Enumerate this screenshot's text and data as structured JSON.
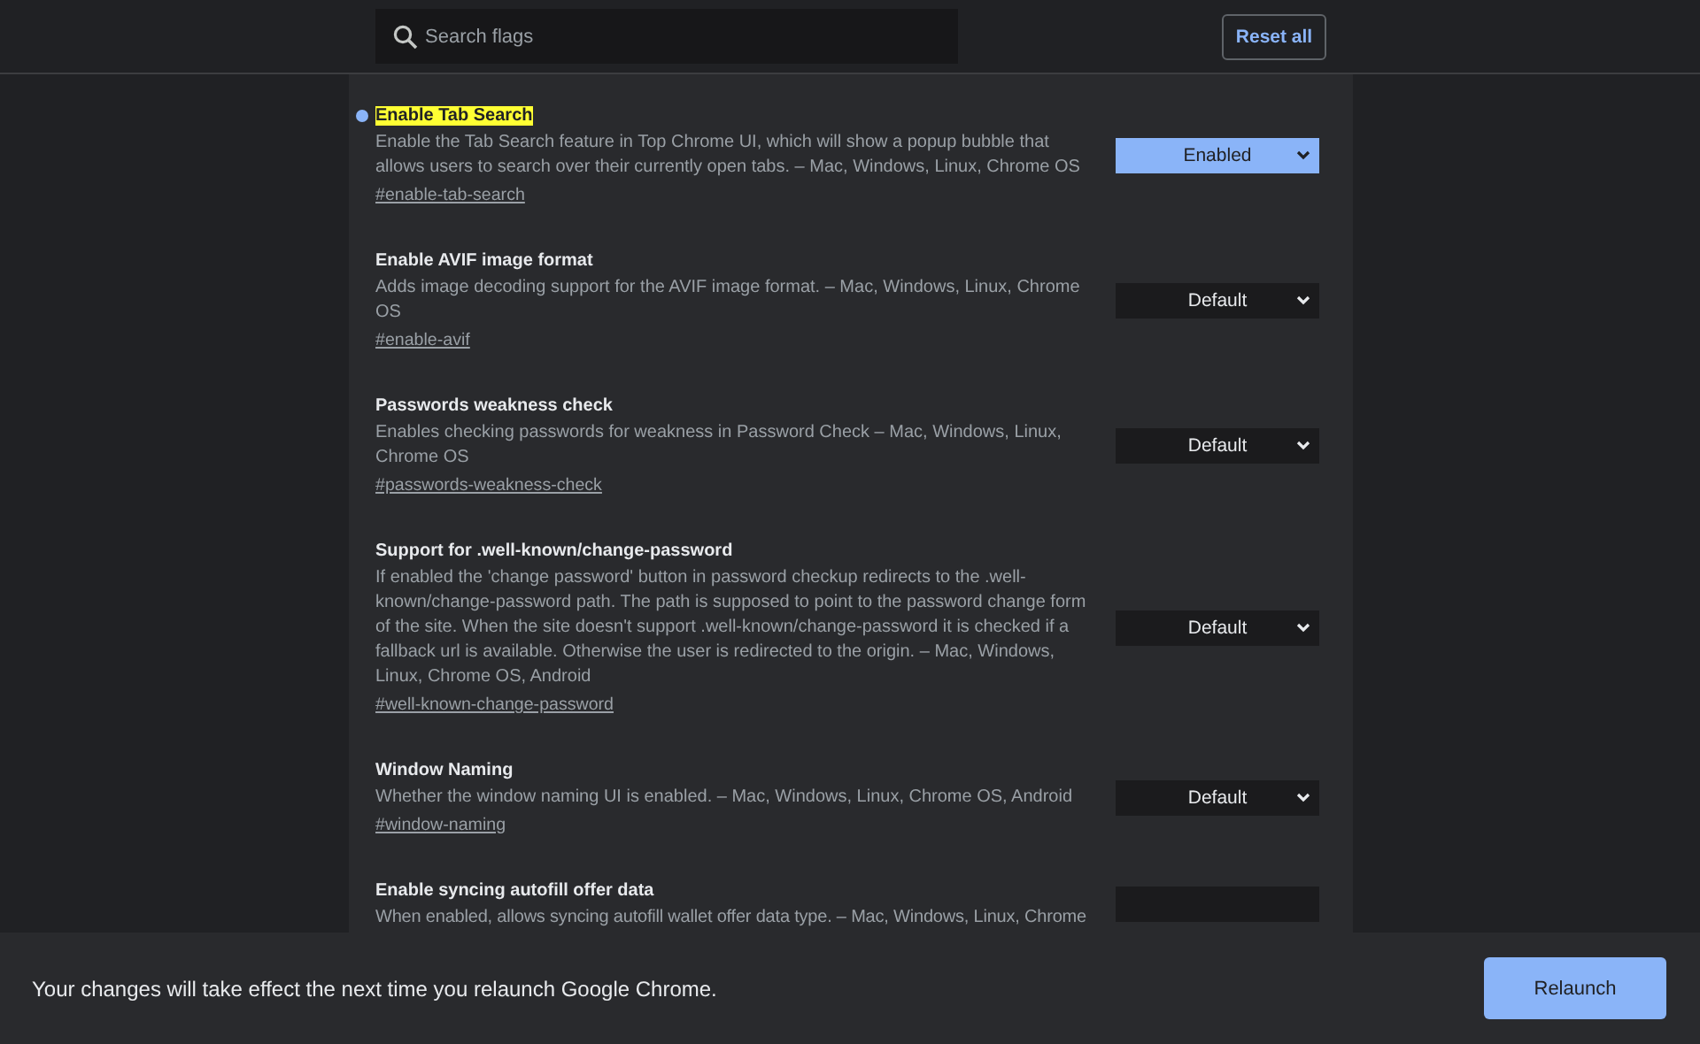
{
  "search": {
    "placeholder": "Search flags"
  },
  "reset_button": "Reset all",
  "flags": [
    {
      "title": "Enable Tab Search",
      "highlighted": true,
      "modified": true,
      "description": "Enable the Tab Search feature in Top Chrome UI, which will show a popup bubble that allows users to search over their currently open tabs. – Mac, Windows, Linux, Chrome OS",
      "link": "#enable-tab-search",
      "value": "Enabled"
    },
    {
      "title": "Enable AVIF image format",
      "highlighted": false,
      "modified": false,
      "description": "Adds image decoding support for the AVIF image format. – Mac, Windows, Linux, Chrome OS",
      "link": "#enable-avif",
      "value": "Default"
    },
    {
      "title": "Passwords weakness check",
      "highlighted": false,
      "modified": false,
      "description": "Enables checking passwords for weakness in Password Check – Mac, Windows, Linux, Chrome OS",
      "link": "#passwords-weakness-check",
      "value": "Default"
    },
    {
      "title": "Support for .well-known/change-password",
      "highlighted": false,
      "modified": false,
      "description": "If enabled the 'change password' button in password checkup redirects to the .well-known/change-password path. The path is supposed to point to the password change form of the site. When the site doesn't support .well-known/change-password it is checked if a fallback url is available. Otherwise the user is redirected to the origin. – Mac, Windows, Linux, Chrome OS, Android",
      "link": "#well-known-change-password",
      "value": "Default"
    },
    {
      "title": "Window Naming",
      "highlighted": false,
      "modified": false,
      "description": "Whether the window naming UI is enabled. – Mac, Windows, Linux, Chrome OS, Android",
      "link": "#window-naming",
      "value": "Default"
    },
    {
      "title": "Enable syncing autofill offer data",
      "highlighted": false,
      "modified": false,
      "description": "When enabled, allows syncing autofill wallet offer data type. – Mac, Windows, Linux, Chrome"
    }
  ],
  "footer": {
    "message": "Your changes will take effect the next time you relaunch Google Chrome.",
    "button": "Relaunch"
  }
}
